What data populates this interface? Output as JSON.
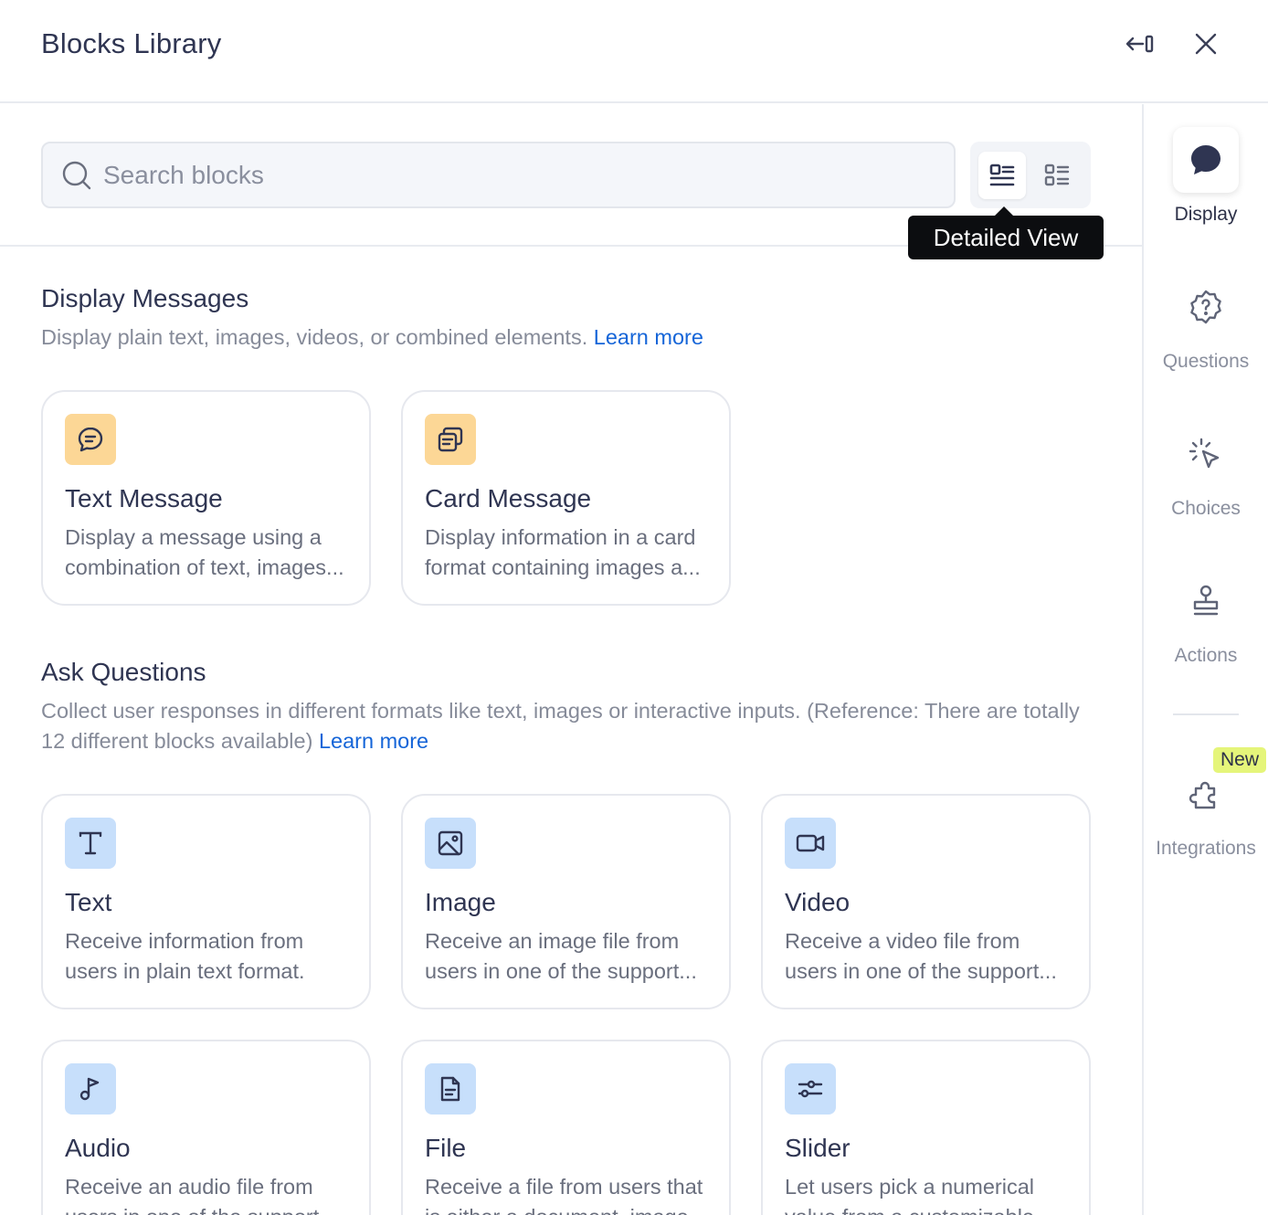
{
  "header": {
    "title": "Blocks Library"
  },
  "search": {
    "placeholder": "Search blocks",
    "value": ""
  },
  "view_toggle": {
    "tooltip": "Detailed View",
    "selected": "detailed"
  },
  "sections": [
    {
      "title": "Display Messages",
      "description": "Display plain text, images, videos, or combined elements.",
      "learn_more": "Learn more",
      "cards": [
        {
          "icon": "chat-message-icon",
          "title": "Text Message",
          "description": "Display a message using a combination of text, images..."
        },
        {
          "icon": "card-stack-icon",
          "title": "Card Message",
          "description": "Display information in a card format containing images a..."
        }
      ]
    },
    {
      "title": "Ask Questions",
      "description": "Collect user responses in different formats like text, images or interactive inputs. (Reference: There are totally 12 different blocks available)",
      "learn_more": "Learn more",
      "cards": [
        {
          "icon": "text-t-icon",
          "title": "Text",
          "description": "Receive information from users in plain text format."
        },
        {
          "icon": "image-icon",
          "title": "Image",
          "description": "Receive an image file from users in one of the support..."
        },
        {
          "icon": "video-camera-icon",
          "title": "Video",
          "description": "Receive a video file from users in one of the support..."
        },
        {
          "icon": "music-note-icon",
          "title": "Audio",
          "description": "Receive an audio file from users in one of the support..."
        },
        {
          "icon": "file-icon",
          "title": "File",
          "description": "Receive a file from users that is either a document, image..."
        },
        {
          "icon": "slider-icon",
          "title": "Slider",
          "description": "Let users pick a numerical value from a customizable..."
        }
      ]
    }
  ],
  "sidebar": {
    "items": [
      {
        "label": "Display",
        "icon": "chat-bubble-icon",
        "active": true
      },
      {
        "label": "Questions",
        "icon": "question-badge-icon",
        "active": false
      },
      {
        "label": "Choices",
        "icon": "pointer-click-icon",
        "active": false
      },
      {
        "label": "Actions",
        "icon": "stamp-icon",
        "active": false
      },
      {
        "label": "Integrations",
        "icon": "puzzle-icon",
        "active": false,
        "badge": "New"
      }
    ]
  },
  "colors": {
    "accent_link": "#1565d8",
    "orange_icon_bg": "#fcd796",
    "blue_icon_bg": "#c7dffb",
    "new_badge": "#e5f57a"
  }
}
